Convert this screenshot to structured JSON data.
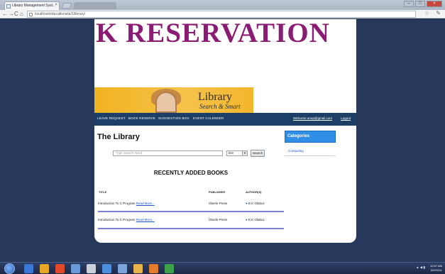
{
  "browser": {
    "tab_title": "Library Management Syst...",
    "url": "localhost/educationsite/1/library/"
  },
  "banner": {
    "title": "K RESERVATION",
    "logo_text": "Library",
    "logo_sub": "Search & Smart"
  },
  "nav": {
    "items": [
      "LEAVE REQUEST",
      "BOOK RESERVE",
      "SUGGESTION BOX",
      "EVENT CALENDER"
    ],
    "welcome": "Welcome anup@gmail.com",
    "logout": "Logout"
  },
  "main": {
    "heading": "The Library",
    "search_placeholder": "Type Search Word",
    "search_select": "title",
    "search_button": "Search",
    "section_title": "RECENTLY ADDED BOOKS",
    "columns": [
      "TITLE",
      "PUBLISHER",
      "AUTHOR(S)"
    ],
    "rows": [
      {
        "title": "Introduction To C Program",
        "read_more": "Read More...",
        "publisher": "Oberle Press",
        "author": "E.K Olabuz"
      },
      {
        "title": "Introduction To C Program",
        "read_more": "Read More...",
        "publisher": "Oberle Press",
        "author": "E.K Olabuz"
      }
    ]
  },
  "sidebar": {
    "categories_title": "Categories",
    "category_link": "Computing"
  },
  "taskbar": {
    "time": "12:07 AM",
    "date": "5/2/2014"
  }
}
